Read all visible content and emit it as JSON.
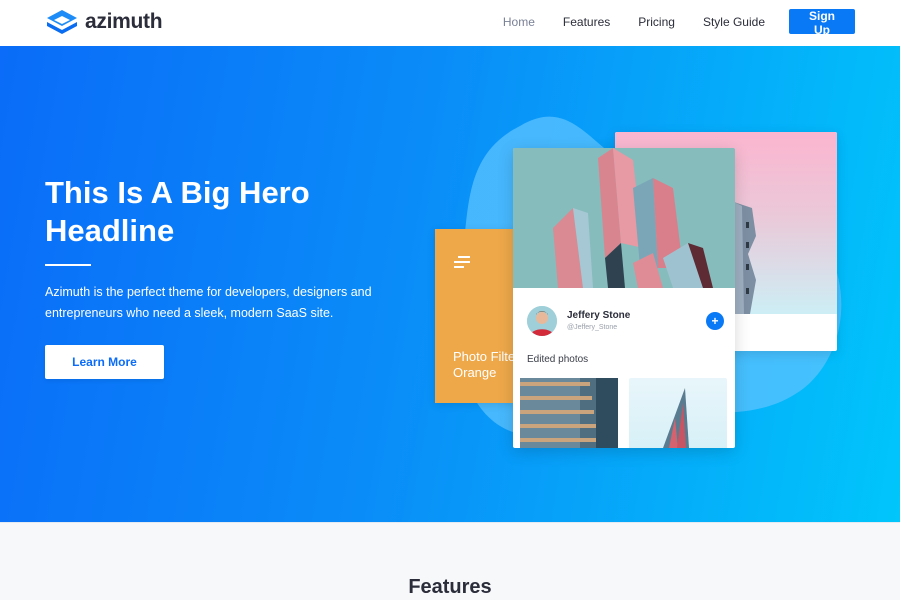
{
  "header": {
    "brand": "azimuth",
    "logo_icon": "stacked-diamond-logo-icon",
    "nav": [
      {
        "label": "Home",
        "active": true
      },
      {
        "label": "Features",
        "active": false
      },
      {
        "label": "Pricing",
        "active": false
      },
      {
        "label": "Style Guide",
        "active": false
      }
    ],
    "cta_label": "Sign Up"
  },
  "hero": {
    "title": "This Is A Big Hero Headline",
    "description": "Azimuth is the perfect theme for developers, designers and entrepreneurs who need a sleek, modern SaaS site.",
    "button_label": "Learn More",
    "gradient": [
      "#0a6cf8",
      "#00c6fb"
    ]
  },
  "illustration": {
    "orange_card": {
      "icon": "menu-lines-icon",
      "label_line1": "Photo Filter",
      "label_line2": "Orange",
      "color": "#eea84a"
    },
    "profile_card": {
      "name": "Jeffery Stone",
      "handle": "@Jeffery_Stone",
      "action_icon": "plus-icon",
      "section_label": "Edited photos"
    }
  },
  "features": {
    "title": "Features"
  },
  "colors": {
    "accent": "#0a79f6",
    "text_dark": "#2b2d3a",
    "muted": "#7a8196",
    "section_bg": "#f7f8fa"
  }
}
